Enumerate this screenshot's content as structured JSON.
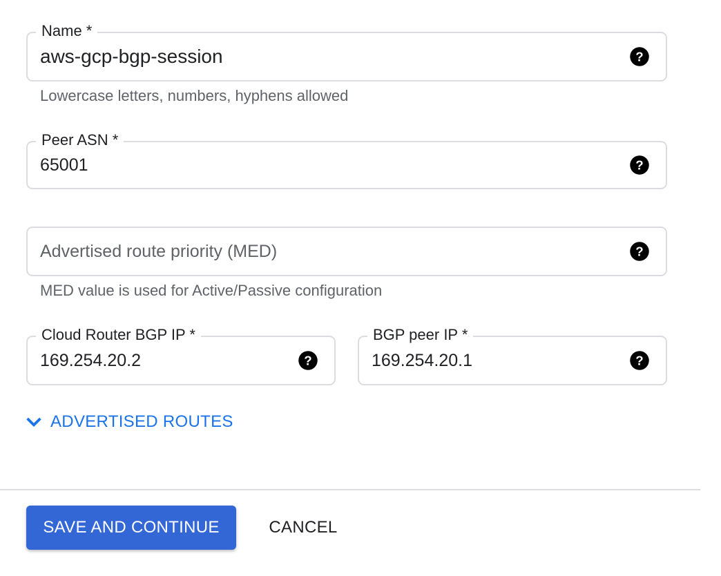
{
  "form": {
    "name": {
      "label": "Name *",
      "value": "aws-gcp-bgp-session",
      "helper": "Lowercase letters, numbers, hyphens allowed"
    },
    "peer_asn": {
      "label": "Peer ASN *",
      "value": "65001"
    },
    "med": {
      "placeholder": "Advertised route priority (MED)",
      "value": "",
      "helper": "MED value is used for Active/Passive configuration"
    },
    "cloud_router_ip": {
      "label": "Cloud Router BGP IP *",
      "value": "169.254.20.2"
    },
    "peer_ip": {
      "label": "BGP peer IP *",
      "value": "169.254.20.1"
    },
    "advertised_routes": {
      "label": "ADVERTISED ROUTES",
      "icon": "chevron-down-icon"
    }
  },
  "actions": {
    "save_label": "SAVE AND CONTINUE",
    "cancel_label": "CANCEL"
  },
  "icons": {
    "help": "help-circle-icon"
  },
  "colors": {
    "primary": "#3367d6",
    "link": "#1a73e8",
    "border": "#dadce0",
    "text": "#202124",
    "secondary_text": "#5f6368"
  }
}
